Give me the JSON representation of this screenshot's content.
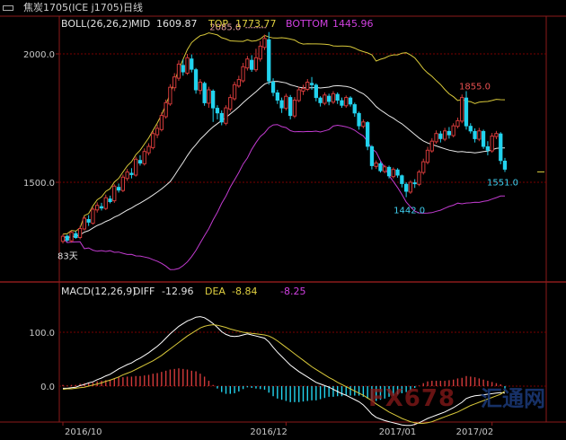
{
  "title": "焦炭1705(ICE j1705)日线",
  "boll_legend": {
    "name": "BOLL(26,26,2)",
    "mid_label": "MID",
    "mid_value": "1609.87",
    "top_label": "TOP",
    "top_value": "1773.77",
    "bottom_label": "BOTTOM",
    "bottom_value": "1445.96"
  },
  "macd_legend": {
    "name": "MACD(12,26,9)",
    "diff_label": "DIFF",
    "diff_value": "-12.96",
    "dea_label": "DEA",
    "dea_value": "-8.84",
    "macd_value": "-8.25"
  },
  "colors": {
    "up": "#d23a3a",
    "down": "#22d3ee",
    "mid": "#e8e8e8",
    "upper": "#d9c93a",
    "lower": "#c23bd0",
    "grid": "#7a0000",
    "axis": "#8b1a1a",
    "text": "#c8c8c8"
  },
  "watermark": {
    "a": "FX678",
    "b": "汇通网"
  },
  "chart_data": {
    "type": "candlestick",
    "price_ticks": [
      "2000.0",
      "1500.0"
    ],
    "price_tick_values": [
      2000,
      1500
    ],
    "macd_ticks": [
      "100.0",
      "0.0"
    ],
    "macd_tick_values": [
      100,
      0
    ],
    "date_ticks": [
      "2016/10",
      "2016/12",
      "2017/01",
      "2017/02"
    ],
    "date_tick_index": [
      0,
      52,
      82,
      100
    ],
    "annotations": {
      "high": {
        "text": "2085.0",
        "index": 48,
        "value": 2085
      },
      "low": {
        "text": "1442.0",
        "index": 80,
        "value": 1442
      },
      "peak2": {
        "text": "1855.0",
        "index": 94,
        "value": 1855
      },
      "last": {
        "text": "1551.0",
        "index": 103,
        "value": 1551
      },
      "left": {
        "text": "83天",
        "index": 0,
        "value": 1285
      }
    },
    "candles": [
      [
        1270,
        1290,
        1262,
        1298
      ],
      [
        1290,
        1275,
        1268,
        1296
      ],
      [
        1272,
        1305,
        1265,
        1312
      ],
      [
        1300,
        1285,
        1280,
        1310
      ],
      [
        1285,
        1320,
        1278,
        1330
      ],
      [
        1318,
        1360,
        1312,
        1368
      ],
      [
        1355,
        1345,
        1330,
        1372
      ],
      [
        1340,
        1395,
        1335,
        1402
      ],
      [
        1392,
        1410,
        1382,
        1422
      ],
      [
        1405,
        1400,
        1390,
        1420
      ],
      [
        1398,
        1440,
        1392,
        1452
      ],
      [
        1435,
        1425,
        1418,
        1448
      ],
      [
        1428,
        1485,
        1420,
        1492
      ],
      [
        1480,
        1470,
        1460,
        1495
      ],
      [
        1468,
        1520,
        1462,
        1530
      ],
      [
        1515,
        1540,
        1505,
        1552
      ],
      [
        1535,
        1530,
        1515,
        1555
      ],
      [
        1528,
        1590,
        1522,
        1600
      ],
      [
        1585,
        1575,
        1565,
        1605
      ],
      [
        1572,
        1620,
        1565,
        1632
      ],
      [
        1615,
        1640,
        1605,
        1652
      ],
      [
        1635,
        1690,
        1628,
        1700
      ],
      [
        1685,
        1710,
        1672,
        1725
      ],
      [
        1705,
        1760,
        1698,
        1772
      ],
      [
        1755,
        1810,
        1748,
        1822
      ],
      [
        1805,
        1870,
        1798,
        1882
      ],
      [
        1868,
        1910,
        1855,
        1925
      ],
      [
        1905,
        1960,
        1895,
        1975
      ],
      [
        1955,
        1930,
        1915,
        1978
      ],
      [
        1925,
        1985,
        1918,
        2000
      ],
      [
        1980,
        1940,
        1928,
        1998
      ],
      [
        1938,
        1860,
        1845,
        1945
      ],
      [
        1858,
        1890,
        1842,
        1902
      ],
      [
        1885,
        1810,
        1798,
        1892
      ],
      [
        1808,
        1860,
        1790,
        1872
      ],
      [
        1855,
        1790,
        1735,
        1862
      ],
      [
        1788,
        1770,
        1745,
        1800
      ],
      [
        1768,
        1735,
        1722,
        1780
      ],
      [
        1730,
        1790,
        1722,
        1800
      ],
      [
        1785,
        1830,
        1775,
        1842
      ],
      [
        1825,
        1880,
        1818,
        1892
      ],
      [
        1875,
        1900,
        1868,
        1915
      ],
      [
        1895,
        1950,
        1888,
        1965
      ],
      [
        1945,
        1980,
        1935,
        1992
      ],
      [
        1975,
        1940,
        1930,
        1995
      ],
      [
        1938,
        1985,
        1930,
        2020
      ],
      [
        1980,
        2030,
        1970,
        2050
      ],
      [
        2025,
        2060,
        2015,
        2075
      ],
      [
        2055,
        1895,
        1880,
        2085
      ],
      [
        1890,
        1850,
        1835,
        1905
      ],
      [
        1848,
        1820,
        1805,
        1860
      ],
      [
        1818,
        1790,
        1770,
        1830
      ],
      [
        1788,
        1835,
        1780,
        1845
      ],
      [
        1830,
        1760,
        1745,
        1840
      ],
      [
        1758,
        1820,
        1750,
        1832
      ],
      [
        1818,
        1860,
        1812,
        1872
      ],
      [
        1855,
        1865,
        1840,
        1880
      ],
      [
        1862,
        1890,
        1855,
        1902
      ],
      [
        1885,
        1880,
        1860,
        1910
      ],
      [
        1878,
        1830,
        1815,
        1885
      ],
      [
        1828,
        1810,
        1795,
        1835
      ],
      [
        1808,
        1840,
        1800,
        1850
      ],
      [
        1835,
        1815,
        1800,
        1845
      ],
      [
        1812,
        1845,
        1805,
        1855
      ],
      [
        1842,
        1820,
        1805,
        1850
      ],
      [
        1818,
        1800,
        1790,
        1830
      ],
      [
        1798,
        1830,
        1790,
        1838
      ],
      [
        1828,
        1805,
        1795,
        1835
      ],
      [
        1802,
        1770,
        1755,
        1810
      ],
      [
        1768,
        1720,
        1705,
        1775
      ],
      [
        1718,
        1735,
        1710,
        1745
      ],
      [
        1732,
        1640,
        1625,
        1738
      ],
      [
        1638,
        1565,
        1550,
        1645
      ],
      [
        1562,
        1575,
        1552,
        1585
      ],
      [
        1572,
        1545,
        1538,
        1580
      ],
      [
        1542,
        1560,
        1535,
        1568
      ],
      [
        1558,
        1525,
        1515,
        1565
      ],
      [
        1522,
        1550,
        1515,
        1558
      ],
      [
        1548,
        1528,
        1518,
        1555
      ],
      [
        1525,
        1495,
        1480,
        1530
      ],
      [
        1492,
        1465,
        1442,
        1500
      ],
      [
        1462,
        1500,
        1455,
        1508
      ],
      [
        1498,
        1495,
        1478,
        1512
      ],
      [
        1492,
        1540,
        1485,
        1548
      ],
      [
        1538,
        1580,
        1530,
        1592
      ],
      [
        1578,
        1625,
        1570,
        1638
      ],
      [
        1622,
        1660,
        1615,
        1672
      ],
      [
        1658,
        1690,
        1650,
        1702
      ],
      [
        1688,
        1670,
        1655,
        1700
      ],
      [
        1668,
        1700,
        1660,
        1712
      ],
      [
        1698,
        1685,
        1670,
        1715
      ],
      [
        1682,
        1720,
        1675,
        1730
      ],
      [
        1718,
        1740,
        1710,
        1752
      ],
      [
        1738,
        1830,
        1730,
        1842
      ],
      [
        1828,
        1720,
        1705,
        1855
      ],
      [
        1718,
        1700,
        1690,
        1730
      ],
      [
        1698,
        1670,
        1655,
        1710
      ],
      [
        1668,
        1700,
        1660,
        1712
      ],
      [
        1698,
        1640,
        1630,
        1705
      ],
      [
        1638,
        1625,
        1605,
        1660
      ],
      [
        1622,
        1680,
        1615,
        1692
      ],
      [
        1678,
        1690,
        1668,
        1700
      ],
      [
        1688,
        1585,
        1570,
        1695
      ],
      [
        1582,
        1551,
        1540,
        1595
      ]
    ],
    "diff": [
      -4,
      -4,
      -3,
      -2,
      1,
      3,
      6,
      8,
      12,
      15,
      19,
      22,
      27,
      32,
      36,
      40,
      43,
      48,
      52,
      57,
      62,
      68,
      74,
      81,
      89,
      97,
      104,
      111,
      116,
      121,
      124,
      128,
      129,
      127,
      122,
      116,
      109,
      101,
      96,
      93,
      92,
      93,
      95,
      97,
      95,
      93,
      91,
      89,
      82,
      72,
      63,
      55,
      47,
      39,
      33,
      27,
      22,
      17,
      12,
      7,
      4,
      1,
      -2,
      -6,
      -10,
      -14,
      -17,
      -21,
      -25,
      -29,
      -35,
      -43,
      -52,
      -58,
      -61,
      -64,
      -66,
      -68,
      -70,
      -72,
      -73,
      -73,
      -71,
      -68,
      -64,
      -60,
      -57,
      -54,
      -51,
      -48,
      -44,
      -40,
      -35,
      -30,
      -23,
      -20,
      -18,
      -17,
      -16,
      -15,
      -14,
      -13,
      -12,
      -13
    ],
    "dea": [
      -6,
      -5,
      -5,
      -4,
      -3,
      -2,
      0,
      2,
      4,
      6,
      9,
      11,
      14,
      17,
      21,
      24,
      27,
      31,
      35,
      39,
      43,
      47,
      52,
      57,
      63,
      69,
      75,
      81,
      87,
      93,
      98,
      103,
      108,
      111,
      113,
      114,
      113,
      111,
      109,
      106,
      104,
      102,
      100,
      99,
      98,
      97,
      96,
      95,
      93,
      89,
      84,
      78,
      72,
      66,
      60,
      54,
      48,
      42,
      36,
      31,
      26,
      21,
      16,
      12,
      7,
      3,
      -1,
      -5,
      -9,
      -13,
      -17,
      -22,
      -27,
      -33,
      -38,
      -43,
      -48,
      -52,
      -56,
      -60,
      -63,
      -66,
      -68,
      -69,
      -69,
      -68,
      -66,
      -63,
      -60,
      -57,
      -54,
      -51,
      -48,
      -44,
      -40,
      -36,
      -33,
      -30,
      -27,
      -24,
      -21,
      -18,
      -15,
      -9
    ]
  }
}
